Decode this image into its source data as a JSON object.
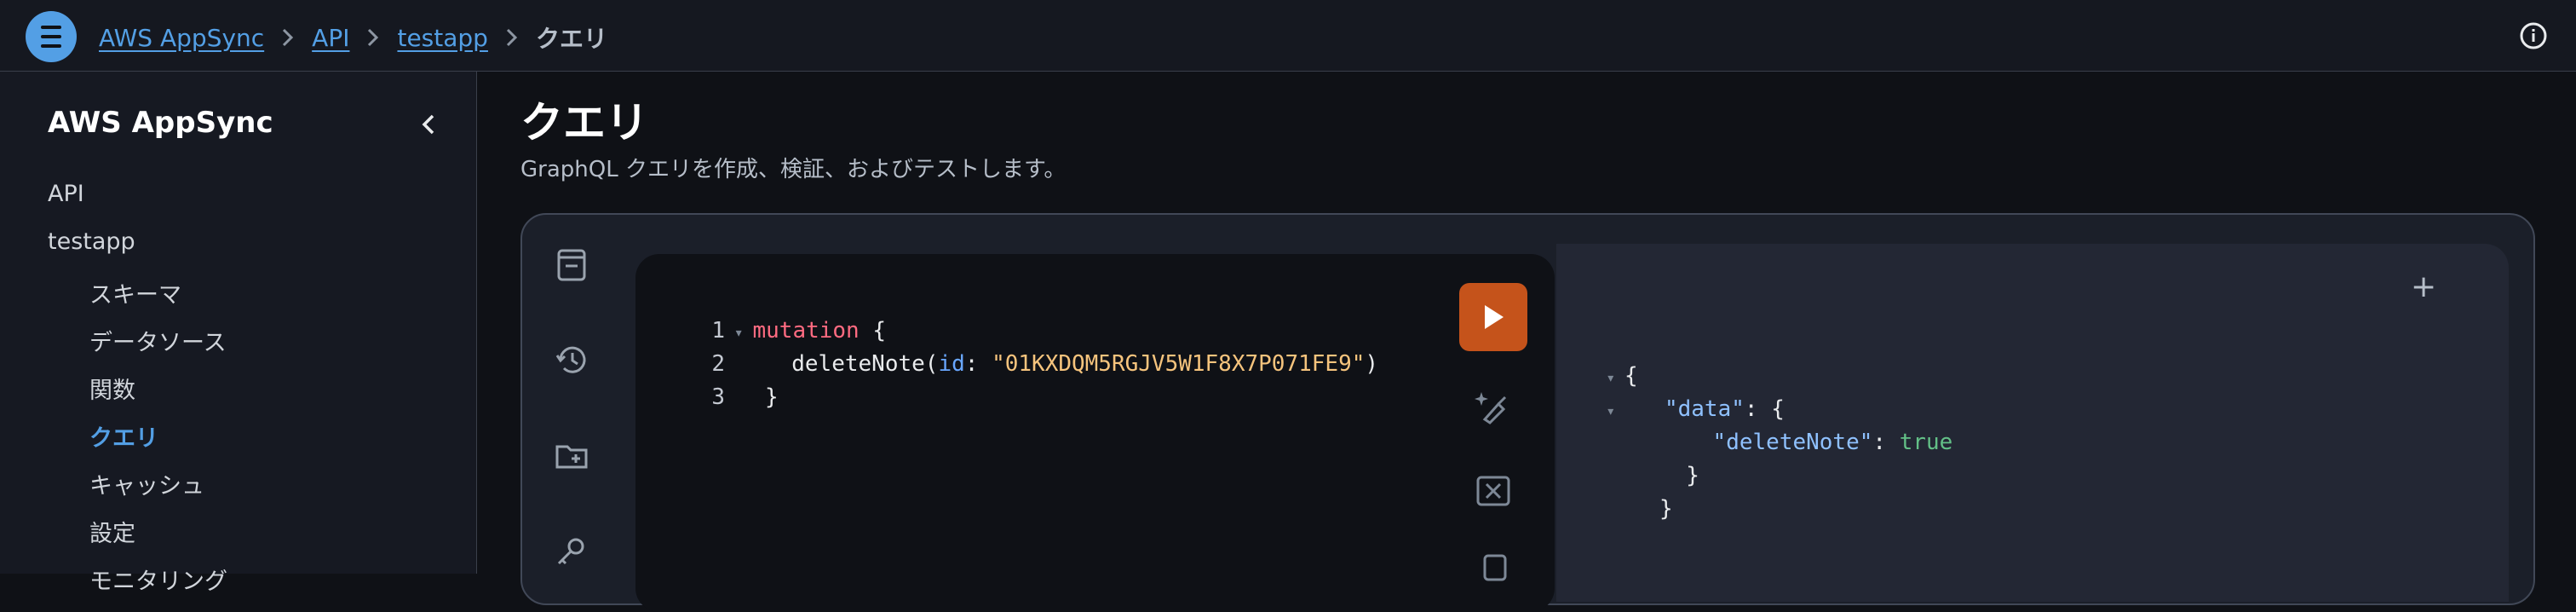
{
  "breadcrumb": {
    "items": [
      "AWS AppSync",
      "API",
      "testapp"
    ],
    "current": "クエリ"
  },
  "sidebar": {
    "title": "AWS AppSync",
    "items": [
      {
        "label": "API"
      },
      {
        "label": "testapp"
      },
      {
        "label": "スキーマ"
      },
      {
        "label": "データソース"
      },
      {
        "label": "関数"
      },
      {
        "label": "クエリ",
        "active": true
      },
      {
        "label": "キャッシュ"
      },
      {
        "label": "設定"
      },
      {
        "label": "モニタリング"
      }
    ]
  },
  "page": {
    "title": "クエリ",
    "description": "GraphQL クエリを作成、検証、およびテストします。"
  },
  "editor": {
    "lines": [
      {
        "num": "1",
        "keyword": "mutation",
        "rest": " {"
      },
      {
        "num": "2",
        "call": "deleteNote",
        "arg": "id",
        "value": "\"01KXDQM5RGJV5W1F8X7P071FE9\""
      },
      {
        "num": "3",
        "rest": "}"
      }
    ]
  },
  "result": {
    "open1": "{",
    "data_key": "\"data\"",
    "open2": "{",
    "deleteNote_key": "\"deleteNote\"",
    "deleteNote_value": "true",
    "close2": "}",
    "close1": "}"
  },
  "colors": {
    "accent": "#539fe5",
    "run_button": "#c5531b"
  },
  "icons": [
    "menu-icon",
    "chevron-right-icon",
    "info-icon",
    "chevron-left-icon",
    "document-icon",
    "history-icon",
    "folder-add-icon",
    "key-icon",
    "play-icon",
    "prettify-icon",
    "merge-fragments-icon",
    "copy-icon",
    "plus-icon"
  ]
}
